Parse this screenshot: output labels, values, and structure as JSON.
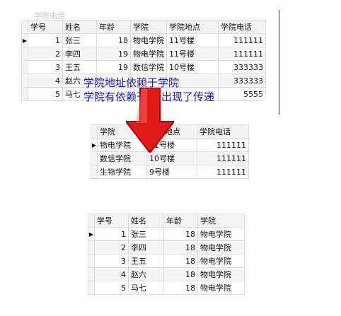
{
  "ghost_header": "学院电话",
  "table1": {
    "headers": [
      "学号",
      "姓名",
      "年龄",
      "学院",
      "学院地点",
      "学院电话"
    ],
    "rows": [
      [
        "1",
        "张三",
        "18",
        "物电学院",
        "11号楼",
        "111111"
      ],
      [
        "2",
        "李四",
        "19",
        "物电学院",
        "11号楼",
        "111111"
      ],
      [
        "3",
        "王五",
        "19",
        "数信学院",
        "10号楼",
        "333333"
      ],
      [
        "4",
        "赵六",
        "",
        "",
        "",
        "333333"
      ],
      [
        "5",
        "马七",
        "",
        "",
        "",
        "5555"
      ]
    ]
  },
  "annotation": {
    "line1": "学院地址依赖于学院",
    "line2": "学院有依赖于人:出现了传递"
  },
  "table2": {
    "headers": [
      "学院",
      "学院地点",
      "学院电话"
    ],
    "rows": [
      [
        "物电学院",
        "11号楼",
        "111111"
      ],
      [
        "数信学院",
        "10号楼",
        "111111"
      ],
      [
        "生物学院",
        "9号楼",
        "111111"
      ]
    ]
  },
  "table3": {
    "headers": [
      "学号",
      "姓名",
      "年龄",
      "学院"
    ],
    "rows": [
      [
        "1",
        "张三",
        "18",
        "物电学院"
      ],
      [
        "2",
        "李四",
        "18",
        "物电学院"
      ],
      [
        "3",
        "王五",
        "18",
        "物电学院"
      ],
      [
        "4",
        "赵六",
        "18",
        "物电学院"
      ],
      [
        "5",
        "马七",
        "18",
        "物电学院"
      ]
    ]
  },
  "row_marker": "▶",
  "colors": {
    "annotation": "#1515d6",
    "arrow_fill": "#e11a1a",
    "arrow_edge": "#b00000"
  }
}
